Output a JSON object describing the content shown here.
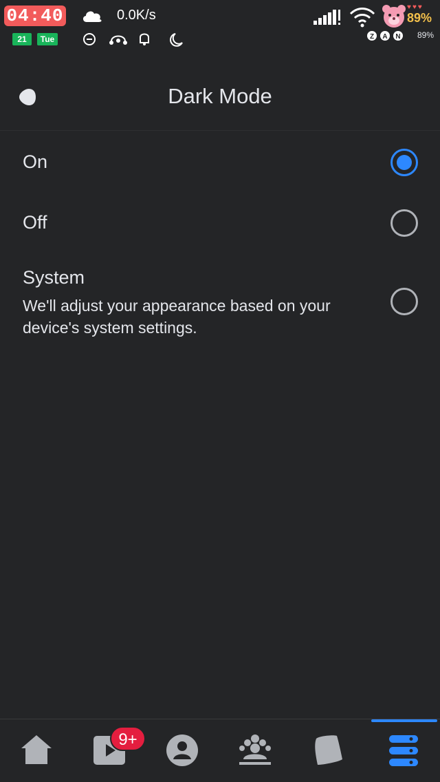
{
  "status_bar": {
    "time": "04:40",
    "date_day": "21",
    "date_weekday": "Tue",
    "net_speed": "0.0K/s",
    "bear_battery": "89%",
    "battery_percent": "89%"
  },
  "header": {
    "title": "Dark Mode"
  },
  "options": [
    {
      "label": "On",
      "description": "",
      "selected": true
    },
    {
      "label": "Off",
      "description": "",
      "selected": false
    },
    {
      "label": "System",
      "description": "We'll adjust your appearance based on your device's system settings.",
      "selected": false
    }
  ],
  "bottom_nav": {
    "items": [
      "home-icon",
      "video-icon",
      "profile-icon",
      "groups-icon",
      "notifications-icon",
      "menu-icon"
    ],
    "active": "menu-icon",
    "video_badge": "9+"
  },
  "colors": {
    "background": "#242527",
    "accent": "#2d88ff",
    "badge": "#e41e3f",
    "time_pill": "#f25b5b"
  }
}
